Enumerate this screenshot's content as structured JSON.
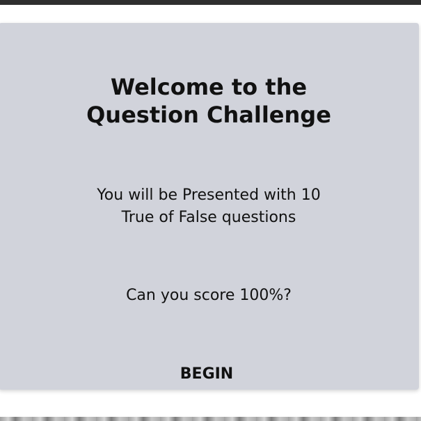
{
  "card": {
    "title": "Welcome to the\nQuestion Challenge",
    "intro": "You will be Presented with 10\nTrue of False questions",
    "question": "Can you score 100%?",
    "begin_label": "BEGIN"
  },
  "colors": {
    "card_background": "#d1d3db",
    "text": "#111111",
    "top_bar": "#2f2f2f"
  }
}
